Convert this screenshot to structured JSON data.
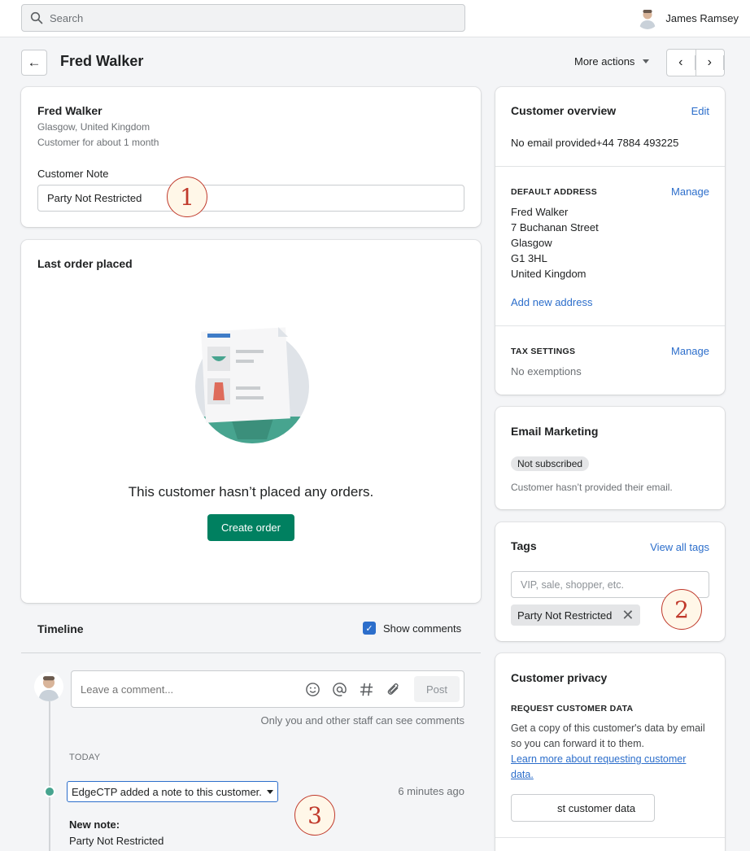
{
  "topbar": {
    "search_placeholder": "Search",
    "user_name": "James Ramsey"
  },
  "header": {
    "title": "Fred Walker",
    "more_actions": "More actions"
  },
  "customer_card": {
    "name": "Fred Walker",
    "location": "Glasgow, United Kingdom",
    "tenure": "Customer for about 1 month",
    "note_label": "Customer Note",
    "note_value": "Party Not Restricted"
  },
  "last_order": {
    "title": "Last order placed",
    "empty_text": "This customer hasn’t placed any orders.",
    "create_order": "Create order"
  },
  "timeline": {
    "title": "Timeline",
    "show_comments": "Show comments",
    "comment_placeholder": "Leave a comment...",
    "post": "Post",
    "helper": "Only you and other staff can see comments",
    "day": "TODAY",
    "event_text": "EdgeCTP added a note to this customer.",
    "event_time": "6 minutes ago",
    "note_heading": "New note:",
    "note_body": "Party Not Restricted"
  },
  "overview": {
    "title": "Customer overview",
    "edit": "Edit",
    "contact": "No email provided+44 7884 493225",
    "address_heading": "DEFAULT ADDRESS",
    "address_manage": "Manage",
    "address_lines": [
      "Fred Walker",
      "7 Buchanan Street",
      "Glasgow",
      "G1 3HL",
      "United Kingdom"
    ],
    "add_address": "Add new address",
    "tax_heading": "TAX SETTINGS",
    "tax_manage": "Manage",
    "tax_value": "No exemptions"
  },
  "email_marketing": {
    "title": "Email Marketing",
    "badge": "Not subscribed",
    "note": "Customer hasn’t provided their email."
  },
  "tags": {
    "title": "Tags",
    "view_all": "View all tags",
    "placeholder": "VIP, sale, shopper, etc.",
    "items": [
      "Party Not Restricted"
    ]
  },
  "privacy": {
    "title": "Customer privacy",
    "heading": "REQUEST CUSTOMER DATA",
    "description": "Get a copy of this customer's data by email so you can forward it to them.",
    "link": "Learn more about requesting customer data.",
    "button": "st customer data"
  },
  "annotations": [
    "1",
    "2",
    "3"
  ],
  "colors": {
    "accent": "#2c6ecb",
    "primary_button": "#008060",
    "annotation": "#c0392b"
  }
}
